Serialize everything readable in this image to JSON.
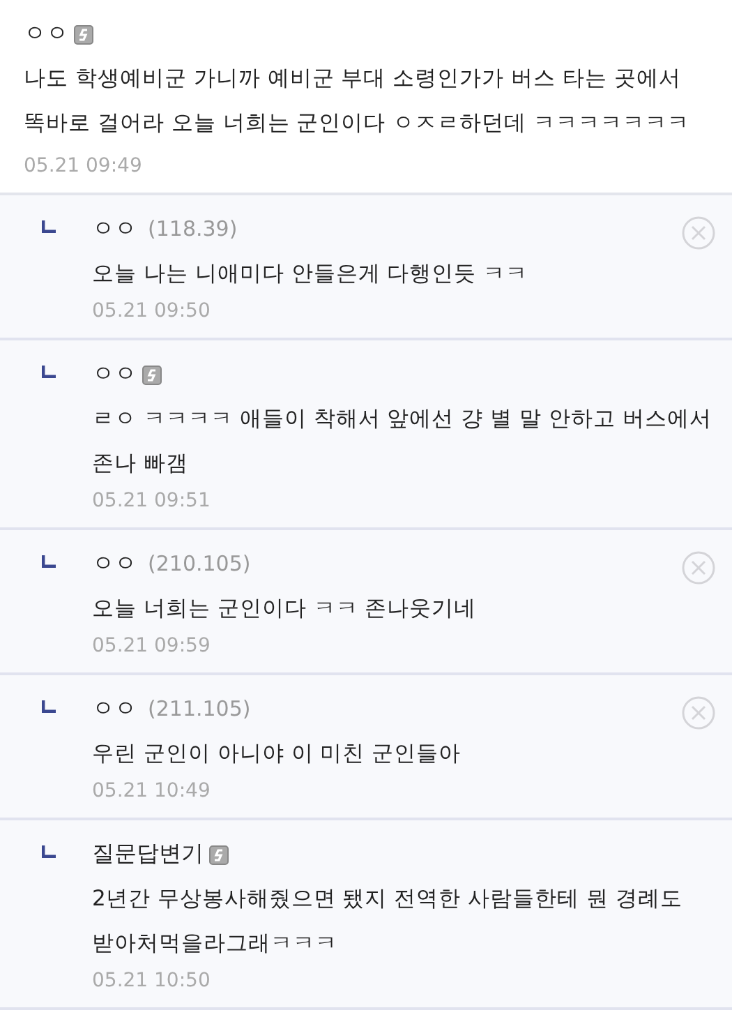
{
  "comment": {
    "nickname": "ㅇㅇ",
    "badge": true,
    "text": "나도 학생예비군 가니까 예비군 부대 소령인가가 버스 타는 곳에서 똑바로 걸어라 오늘 너희는 군인이다 ㅇㅈㄹ하던데 ㅋㅋㅋㅋㅋㅋㅋ",
    "time": "05.21 09:49"
  },
  "replies": [
    {
      "nickname": "ㅇㅇ",
      "ip": "(118.39)",
      "badge": false,
      "deletable": true,
      "text": "오늘 나는 니애미다 안들은게 다행인듯 ㅋㅋ",
      "time": "05.21 09:50"
    },
    {
      "nickname": "ㅇㅇ",
      "badge": true,
      "deletable": false,
      "text": "ㄹㅇ ㅋㅋㅋㅋ 애들이 착해서 앞에선 걍 별 말 안하고 버스에서 존나 빠갬",
      "time": "05.21 09:51"
    },
    {
      "nickname": "ㅇㅇ",
      "ip": "(210.105)",
      "badge": false,
      "deletable": true,
      "text": "오늘 너희는 군인이다 ㅋㅋ 존나웃기네",
      "time": "05.21 09:59"
    },
    {
      "nickname": "ㅇㅇ",
      "ip": "(211.105)",
      "badge": false,
      "deletable": true,
      "text": "우린 군인이 아니야 이 미친 군인들아",
      "time": "05.21 10:49"
    },
    {
      "nickname": "질문답변기",
      "badge": true,
      "deletable": false,
      "text": "2년간 무상봉사해줬으면 됐지 전역한 사람들한테 뭔 경례도 받아처먹을라그래ㅋㅋㅋ",
      "time": "05.21 10:50"
    }
  ]
}
